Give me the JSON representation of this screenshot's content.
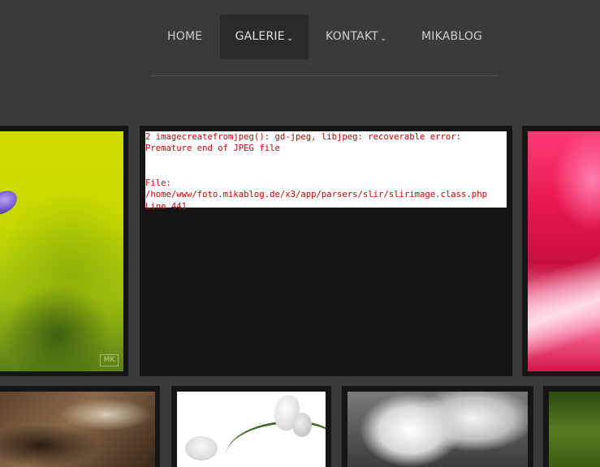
{
  "nav": {
    "items": [
      {
        "label": "HOME"
      },
      {
        "label": "GALERIE",
        "caret": "⌄"
      },
      {
        "label": "KONTAKT",
        "caret": "⌄"
      },
      {
        "label": "MIKABLOG"
      }
    ],
    "active": "GALERIE"
  },
  "gallery": {
    "error": {
      "line1": "2 imagecreatefromjpeg(): gd-jpeg, libjpeg: recoverable error:",
      "line2": "Premature end of JPEG file",
      "line3": "",
      "line4": "",
      "line5": "File:",
      "line6": "/home/www/foto.mikablog.de/x3/app/parsers/slir/slirimage.class.php",
      "line7": "Line 441"
    },
    "watermark": "MK"
  },
  "colors": {
    "background": "#3a3a3a",
    "frame": "#151515",
    "nav_text": "#cfcfcf",
    "nav_active_bg": "#2a2a2a",
    "error_text": "#cc0000"
  }
}
